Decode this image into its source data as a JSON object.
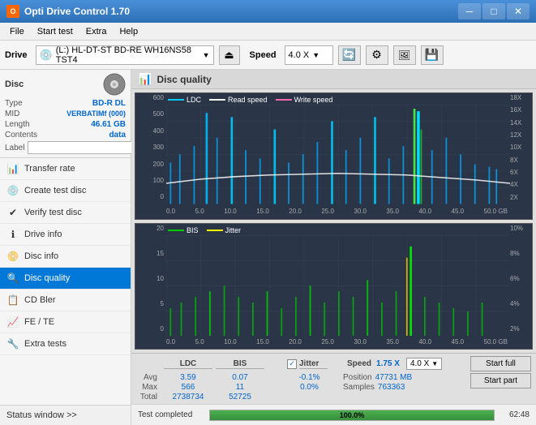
{
  "titleBar": {
    "title": "Opti Drive Control 1.70",
    "minBtn": "─",
    "maxBtn": "□",
    "closeBtn": "✕"
  },
  "menuBar": {
    "items": [
      "File",
      "Start test",
      "Extra",
      "Help"
    ]
  },
  "toolbar": {
    "driveLabel": "Drive",
    "driveValue": "(L:)  HL-DT-ST BD-RE  WH16NS58 TST4",
    "speedLabel": "Speed",
    "speedValue": "4.0 X"
  },
  "leftPanel": {
    "discSectionTitle": "Disc",
    "fields": [
      {
        "label": "Type",
        "value": "BD-R DL"
      },
      {
        "label": "MID",
        "value": "VERBATIMf (000)"
      },
      {
        "label": "Length",
        "value": "46.61 GB"
      },
      {
        "label": "Contents",
        "value": "data"
      }
    ],
    "labelFieldLabel": "Label",
    "navItems": [
      {
        "label": "Transfer rate",
        "icon": "📊"
      },
      {
        "label": "Create test disc",
        "icon": "💿"
      },
      {
        "label": "Verify test disc",
        "icon": "✔"
      },
      {
        "label": "Drive info",
        "icon": "ℹ"
      },
      {
        "label": "Disc info",
        "icon": "📀"
      },
      {
        "label": "Disc quality",
        "icon": "🔍",
        "active": true
      },
      {
        "label": "CD Bler",
        "icon": "📋"
      },
      {
        "label": "FE / TE",
        "icon": "📈"
      },
      {
        "label": "Extra tests",
        "icon": "🔧"
      }
    ],
    "statusWindowBtn": "Status window >>"
  },
  "discQuality": {
    "title": "Disc quality",
    "chart1": {
      "legend": [
        {
          "label": "LDC",
          "color": "#00ccff"
        },
        {
          "label": "Read speed",
          "color": "#ffffff"
        },
        {
          "label": "Write speed",
          "color": "#ff69b4"
        }
      ],
      "yLabels": [
        "600",
        "500",
        "400",
        "300",
        "200",
        "100",
        "0"
      ],
      "yLabelsRight": [
        "18X",
        "16X",
        "14X",
        "12X",
        "10X",
        "8X",
        "6X",
        "4X",
        "2X"
      ],
      "xLabels": [
        "0.0",
        "5.0",
        "10.0",
        "15.0",
        "20.0",
        "25.0",
        "30.0",
        "35.0",
        "40.0",
        "45.0",
        "50.0 GB"
      ]
    },
    "chart2": {
      "legend": [
        {
          "label": "BIS",
          "color": "#00cc00"
        },
        {
          "label": "Jitter",
          "color": "#ffff00"
        }
      ],
      "yLabels": [
        "20",
        "15",
        "10",
        "5",
        "0"
      ],
      "yLabelsRight": [
        "10%",
        "8%",
        "6%",
        "4%",
        "2%"
      ],
      "xLabels": [
        "0.0",
        "5.0",
        "10.0",
        "15.0",
        "20.0",
        "25.0",
        "30.0",
        "35.0",
        "40.0",
        "45.0",
        "50.0 GB"
      ]
    },
    "stats": {
      "headers": [
        "",
        "LDC",
        "BIS",
        "",
        "Jitter",
        "Speed",
        "",
        ""
      ],
      "avgLabel": "Avg",
      "maxLabel": "Max",
      "totalLabel": "Total",
      "ldcAvg": "3.59",
      "ldcMax": "566",
      "ldcTotal": "2738734",
      "bisAvg": "0.07",
      "bisMax": "11",
      "bisTotal": "52725",
      "jitterCheckLabel": "Jitter",
      "jitterAvg": "-0.1%",
      "jitterMax": "0.0%",
      "speedLabel": "Speed",
      "speedValue": "1.75 X",
      "speedDropdown": "4.0 X",
      "positionLabel": "Position",
      "positionValue": "47731 MB",
      "samplesLabel": "Samples",
      "samplesValue": "763363",
      "startFullBtn": "Start full",
      "startPartBtn": "Start part"
    }
  },
  "progressBar": {
    "statusText": "Test completed",
    "percent": 100,
    "percentLabel": "100.0%",
    "time": "62:48"
  }
}
